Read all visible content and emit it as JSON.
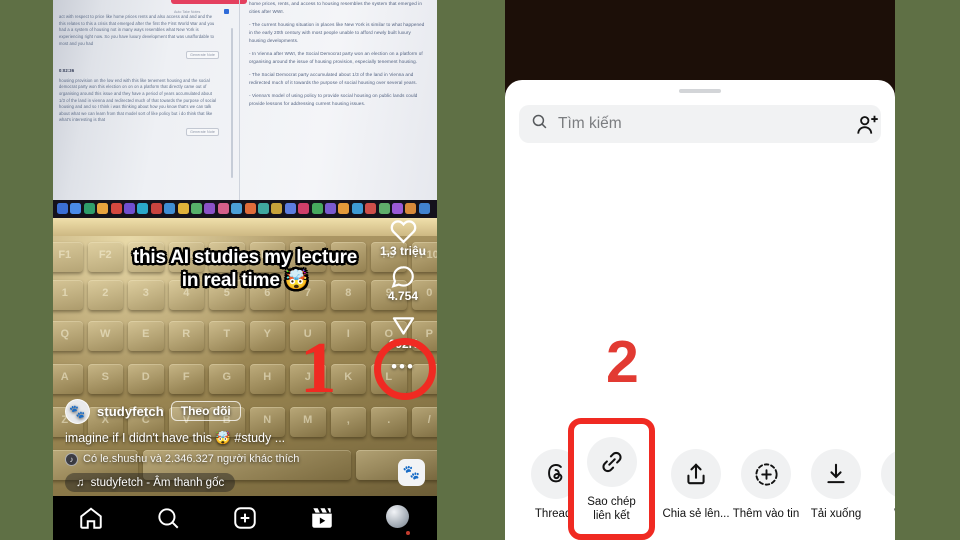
{
  "background_color": "#5f7045",
  "accent_red": "#f02a22",
  "left_panel": {
    "name": "instagram-reel",
    "document_screenshot": {
      "red_banner_label": "",
      "checkbox_label": "Auto Take Notes",
      "timestamp": "0:02:36",
      "generate_note_label": "Generate Note",
      "left_column": [
        "act with respect to price like home prices rents and also access and and and the this relates to this a crisis that emerged after the first the First World War and you had a a system of housing not in many ways resembles what New York is experiencing right now. So you have luxury development that was unaffordable to most and you had",
        "housing provision on the low end with this like tenement housing and the social democrat party won this election on on on a platform that directly came out of organising around this issue and they have a period of years accumulated about 1/3 of the land in vienna and redirected much of that towards the purpose of social housing and and so I think i was thinking about how you know that's we can talk about what we can learn from that model sort of like policy but i do think that like what's interesting is that"
      ],
      "right_column": [
        "home prices, rents, and access to housing resembles the system that emerged in cities after WWI.",
        "- The current housing situation in places like New York is similar to what happened in the early 20th century with most people unable to afford newly built luxury housing developments.",
        "- In Vienna after WWI, the Social Democrat party won an election on a platform of organising around the issue of housing provision, especially tenement housing.",
        "- The Social Democrat party accumulated about 1/3 of the land in Vienna and redirected much of it towards the purpose of social housing over several years.",
        "- Vienna's model of using policy to provide social housing on public lands could provide lessons for addressing current housing issues."
      ]
    },
    "video_caption_line1": "this AI studies my lecture",
    "video_caption_line2": "in real time 🤯",
    "action_rail": {
      "like_icon": "heart-icon",
      "like_count": "1,3 triệu",
      "comment_icon": "comment-icon",
      "comment_count": "4.754",
      "share_icon": "share-paper-plane-icon",
      "share_count": "692K",
      "more_icon": "more-options-icon"
    },
    "account": {
      "avatar": "profile-avatar",
      "username": "studyfetch",
      "follow_label": "Theo dõi"
    },
    "caption": "imagine if I didn't have this 🤯 #study ...",
    "likes_text": "Có le.shushu và 2.346.327 người khác thích",
    "audio_label": "studyfetch - Âm thanh gốc",
    "music_badge_icon": "audio-cover-icon",
    "bottom_nav": [
      {
        "icon": "home-icon",
        "label": "Trang chủ"
      },
      {
        "icon": "search-icon",
        "label": "Tìm kiếm"
      },
      {
        "icon": "create-icon",
        "label": "Tạo"
      },
      {
        "icon": "reels-icon",
        "label": "Reels"
      },
      {
        "icon": "profile-avatar-icon",
        "label": "Trang cá nhân"
      }
    ]
  },
  "right_panel": {
    "name": "share-sheet",
    "search": {
      "icon": "search-icon",
      "placeholder": "Tìm kiếm",
      "value": ""
    },
    "add_person_icon": "add-person-icon",
    "share_options": [
      {
        "icon": "threads-icon",
        "label": "Threads"
      },
      {
        "icon": "link-icon",
        "label": "Sao chép\nliên kết",
        "highlighted": true
      },
      {
        "icon": "share-up-icon",
        "label": "Chia sẻ lên..."
      },
      {
        "icon": "add-to-story-icon",
        "label": "Thêm vào tin"
      },
      {
        "icon": "download-icon",
        "label": "Tải xuống"
      },
      {
        "icon": "whatsapp-icon",
        "label": "Wha"
      }
    ]
  },
  "annotations": {
    "step_one": "1",
    "step_two": "2",
    "circle_target": "share-paper-plane-icon",
    "box_target": "Sao chép liên kết"
  }
}
